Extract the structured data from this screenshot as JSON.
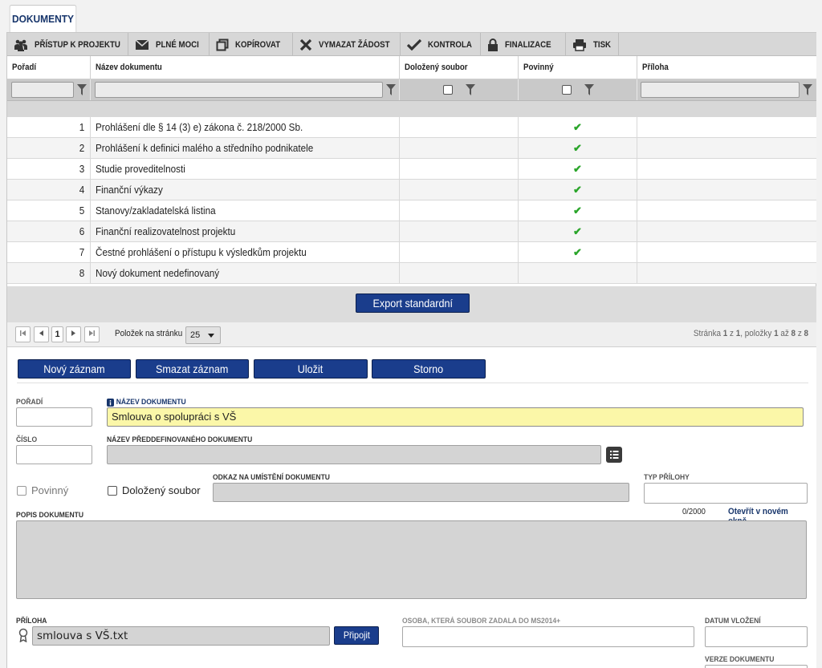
{
  "tabs": {
    "active": "DOKUMENTY"
  },
  "toolbar": {
    "items": [
      {
        "label": "PŘÍSTUP K PROJEKTU",
        "icon": "people-icon"
      },
      {
        "label": "PLNÉ MOCI",
        "icon": "envelope-icon"
      },
      {
        "label": "KOPÍROVAT",
        "icon": "copy-icon"
      },
      {
        "label": "VYMAZAT ŽÁDOST",
        "icon": "x-icon"
      },
      {
        "label": "KONTROLA",
        "icon": "check-icon"
      },
      {
        "label": "FINALIZACE",
        "icon": "lock-icon"
      },
      {
        "label": "TISK",
        "icon": "printer-icon"
      }
    ]
  },
  "grid": {
    "columns": [
      "Pořadí",
      "Název dokumentu",
      "Doložený soubor",
      "Povinný",
      "Příloha"
    ],
    "rows": [
      {
        "poradi": "1",
        "nazev": "Prohlášení dle § 14 (3) e) zákona č. 218/2000 Sb.",
        "povinny": "✔"
      },
      {
        "poradi": "2",
        "nazev": "Prohlášení k definici malého a středního podnikatele",
        "povinny": "✔"
      },
      {
        "poradi": "3",
        "nazev": "Studie proveditelnosti",
        "povinny": "✔"
      },
      {
        "poradi": "4",
        "nazev": "Finanční výkazy",
        "povinny": "✔"
      },
      {
        "poradi": "5",
        "nazev": "Stanovy/zakladatelská listina",
        "povinny": "✔"
      },
      {
        "poradi": "6",
        "nazev": "Finanční realizovatelnost projektu",
        "povinny": "✔"
      },
      {
        "poradi": "7",
        "nazev": "Čestné prohlášení o přístupu k výsledkům projektu",
        "povinny": "✔"
      },
      {
        "poradi": "8",
        "nazev": "Nový dokument nedefinovaný",
        "povinny": ""
      }
    ],
    "export_label": "Export standardní"
  },
  "pager": {
    "current_page": "1",
    "per_page_label": "Položek na stránku",
    "per_page_value": "25",
    "status_prefix": "Stránka ",
    "status_page": "1",
    "status_of": " z ",
    "status_total_pages": "1",
    "status_items": ", položky ",
    "status_from": "1",
    "status_to_word": " až ",
    "status_to": "8",
    "status_z": " z ",
    "status_total": "8"
  },
  "actions": {
    "new": "Nový záznam",
    "delete": "Smazat záznam",
    "save": "Uložit",
    "cancel": "Storno"
  },
  "form": {
    "poradi_label": "POŘADÍ",
    "poradi_value": "",
    "nazev_label": "NÁZEV DOKUMENTU",
    "nazev_value": "Smlouva o spolupráci s VŠ",
    "cislo_label": "ČÍSLO",
    "cislo_value": "",
    "predef_label": "NÁZEV PŘEDDEFINOVANÉHO DOKUMENTU",
    "predef_value": "",
    "povinny_label": "Povinný",
    "dolozeny_label": "Doložený soubor",
    "odkaz_label": "ODKAZ NA UMÍSTĚNÍ DOKUMENTU",
    "odkaz_value": "",
    "typ_label": "TYP PŘÍLOHY",
    "typ_value": "",
    "popis_label": "POPIS DOKUMENTU",
    "popis_count": "0/2000",
    "popis_link": "Otevřít v novém okně",
    "popis_value": "",
    "priloha_label": "PŘÍLOHA",
    "priloha_value": "smlouva s VŠ.txt",
    "pripojit_label": "Připojit",
    "osoba_label": "OSOBA, KTERÁ SOUBOR ZADALA DO MS2014+",
    "osoba_value": "",
    "datum_label": "DATUM VLOŽENÍ",
    "datum_value": "",
    "verze_label": "VERZE DOKUMENTU"
  },
  "colors": {
    "accent": "#1a3d8c",
    "tab_text": "#17356b",
    "check": "#2aa52a",
    "required_field": "#fbf7a8"
  }
}
